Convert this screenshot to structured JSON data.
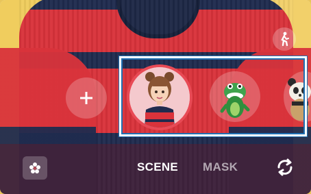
{
  "modes": {
    "scene_label": "SCENE",
    "mask_label": "MASK",
    "selected": "SCENE"
  },
  "effects": {
    "add_icon": "plus-icon",
    "items": [
      {
        "name": "girl-avatar",
        "selected": true
      },
      {
        "name": "dinosaur-avatar",
        "selected": false
      },
      {
        "name": "panda-avatar",
        "selected": false
      }
    ]
  },
  "icons": {
    "top_right": "person-walking-icon",
    "bottom_left": "flower-settings-icon",
    "bottom_right": "switch-camera-icon"
  },
  "colors": {
    "selection_highlight": "#1f6fb2",
    "selected_ring": "#e84a55"
  }
}
